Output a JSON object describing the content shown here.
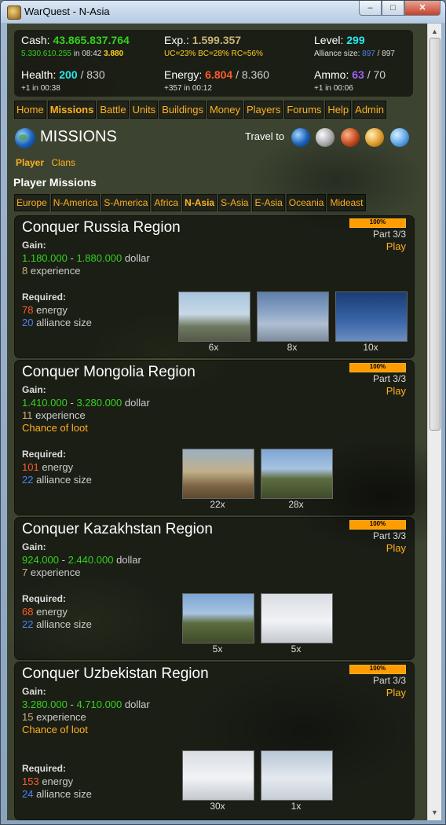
{
  "window": {
    "title": "WarQuest - N-Asia",
    "min": "–",
    "max": "□",
    "close": "✕"
  },
  "stats": {
    "cash_label": "Cash:",
    "cash": "43.865.837.764",
    "cash_rate": "5.330.610.255",
    "cash_time": "in 08:42",
    "cash_bonus": "3.880",
    "exp_label": "Exp.:",
    "exp": "1.599.357",
    "exp_sub": "UC=23% BC=28% RC=56%",
    "level_label": "Level:",
    "level": "299",
    "alliance_label": "Alliance size:",
    "alliance_a": "897",
    "alliance_sep": "/",
    "alliance_b": "897",
    "health_label": "Health:",
    "health": "200",
    "health_sep": "/",
    "health_max": "830",
    "health_sub": "+1 in 00:38",
    "energy_label": "Energy:",
    "energy": "6.804",
    "energy_sep": "/",
    "energy_max": "8.360",
    "energy_sub": "+357 in 00:12",
    "ammo_label": "Ammo:",
    "ammo": "63",
    "ammo_sep": "/",
    "ammo_max": "70",
    "ammo_sub": "+1 in 00:06"
  },
  "nav": [
    "Home",
    "Missions",
    "Battle",
    "Units",
    "Buildings",
    "Money",
    "Players",
    "Forums",
    "Help",
    "Admin"
  ],
  "page_title": "MISSIONS",
  "travel_label": "Travel to",
  "sub_tabs": [
    "Player",
    "Clans"
  ],
  "section_title": "Player Missions",
  "regions": [
    "Europe",
    "N-America",
    "S-America",
    "Africa",
    "N-Asia",
    "S-Asia",
    "E-Asia",
    "Oceania",
    "Mideast"
  ],
  "missions": [
    {
      "title": "Conquer Russia Region",
      "progress_text": "100%",
      "progress": 1.0,
      "part": "Part 3/3",
      "play": "Play",
      "gain_label": "Gain:",
      "gain_min": "1.180.000",
      "gain_dash": "-",
      "gain_max": "1.880.000",
      "gain_unit": "dollar",
      "exp": "8",
      "exp_unit": "experience",
      "loot": "",
      "req_label": "Required:",
      "energy": "78",
      "energy_unit": "energy",
      "alliance": "20",
      "alliance_unit": "alliance size",
      "units": [
        {
          "count": "6x",
          "img": "attack-helicopter"
        },
        {
          "count": "8x",
          "img": "fighter-jet"
        },
        {
          "count": "10x",
          "img": "stealth-jet"
        }
      ]
    },
    {
      "title": "Conquer Mongolia Region",
      "progress_text": "100%",
      "progress": 1.0,
      "part": "Part 3/3",
      "play": "Play",
      "gain_label": "Gain:",
      "gain_min": "1.410.000",
      "gain_dash": "-",
      "gain_max": "3.280.000",
      "gain_unit": "dollar",
      "exp": "11",
      "exp_unit": "experience",
      "loot": "Chance of loot",
      "req_label": "Required:",
      "energy": "101",
      "energy_unit": "energy",
      "alliance": "22",
      "alliance_unit": "alliance size",
      "units": [
        {
          "count": "22x",
          "img": "amphibious-vehicle"
        },
        {
          "count": "28x",
          "img": "rocket-launcher"
        }
      ]
    },
    {
      "title": "Conquer Kazakhstan Region",
      "progress_text": "100%",
      "progress": 1.0,
      "part": "Part 3/3",
      "play": "Play",
      "gain_label": "Gain:",
      "gain_min": "924.000",
      "gain_dash": "-",
      "gain_max": "2.440.000",
      "gain_unit": "dollar",
      "exp": "7",
      "exp_unit": "experience",
      "loot": "",
      "req_label": "Required:",
      "energy": "68",
      "energy_unit": "energy",
      "alliance": "22",
      "alliance_unit": "alliance size",
      "units": [
        {
          "count": "5x",
          "img": "rocket-launcher"
        },
        {
          "count": "5x",
          "img": "apache-helicopter"
        }
      ]
    },
    {
      "title": "Conquer Uzbekistan Region",
      "progress_text": "100%",
      "progress": 1.0,
      "part": "Part 3/3",
      "play": "Play",
      "gain_label": "Gain:",
      "gain_min": "3.280.000",
      "gain_dash": "-",
      "gain_max": "4.710.000",
      "gain_unit": "dollar",
      "exp": "15",
      "exp_unit": "experience",
      "loot": "Chance of loot",
      "req_label": "Required:",
      "energy": "153",
      "energy_unit": "energy",
      "alliance": "24",
      "alliance_unit": "alliance size",
      "units": [
        {
          "count": "30x",
          "img": "apache-helicopter"
        },
        {
          "count": "1x",
          "img": "fighter-jet"
        }
      ]
    }
  ],
  "scrollbar": {
    "up": "▲",
    "down": "▼"
  }
}
